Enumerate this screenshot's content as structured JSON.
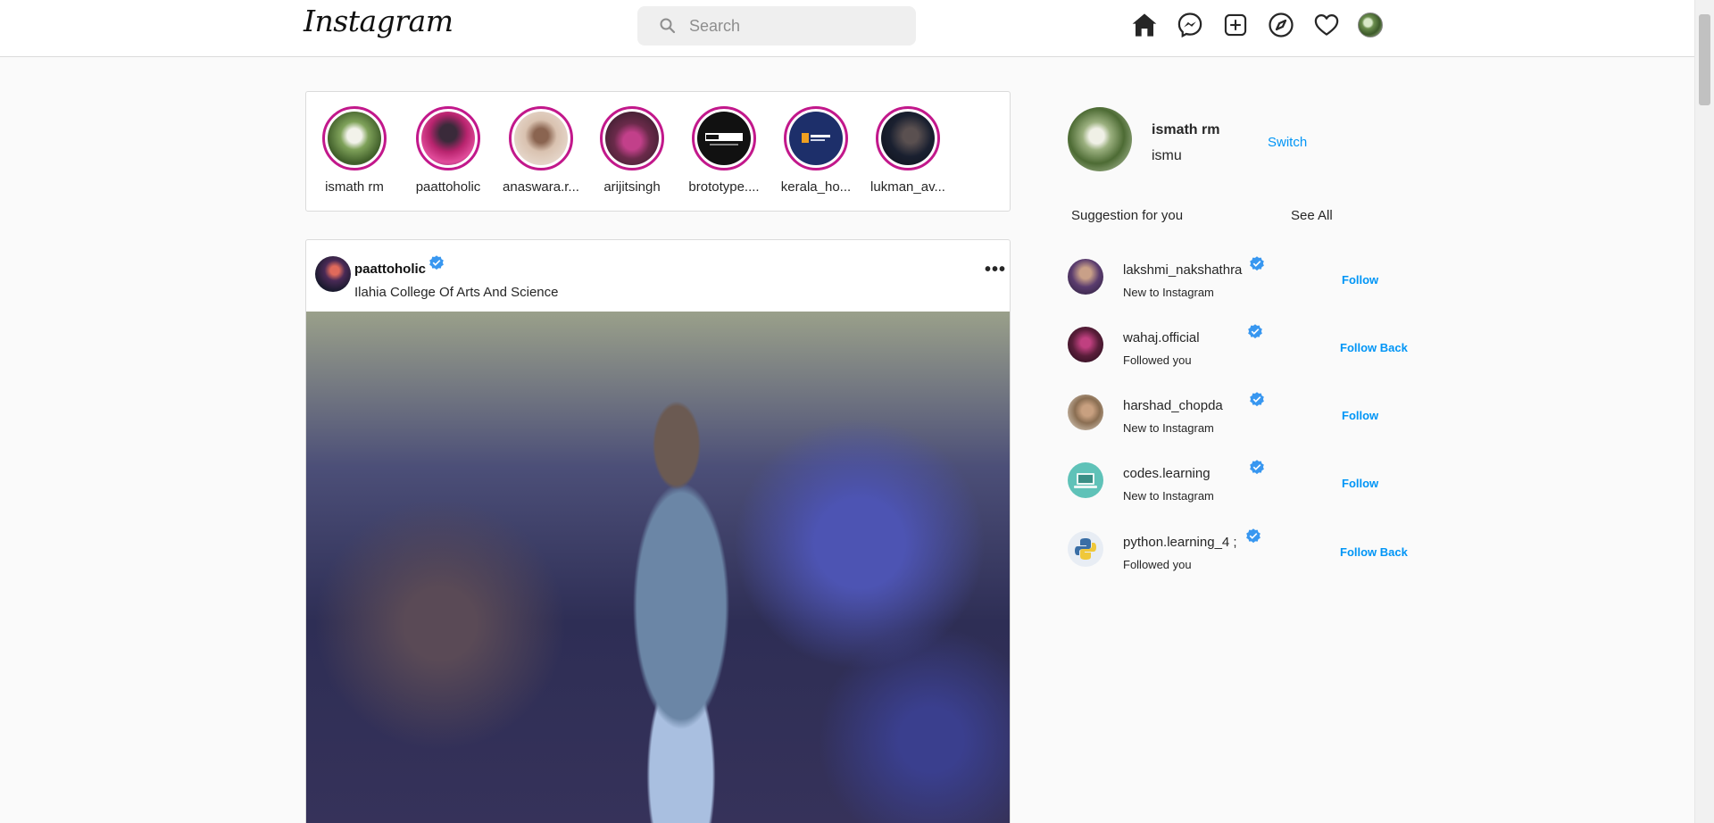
{
  "header": {
    "logo": "Instagram",
    "search_placeholder": "Search",
    "nav_icons": [
      "home-icon",
      "messenger-icon",
      "new-post-icon",
      "explore-icon",
      "activity-icon",
      "profile-avatar"
    ]
  },
  "stories": [
    {
      "name": "ismath rm",
      "color": "#7fa25a"
    },
    {
      "name": "paattoholic",
      "color": "#b8246e"
    },
    {
      "name": "anaswara.r...",
      "color": "#d9c2b0"
    },
    {
      "name": "arijitsingh",
      "color": "#6a2a4a"
    },
    {
      "name": "brototype....",
      "color": "#111111"
    },
    {
      "name": "kerala_ho...",
      "color": "#1d2f6a"
    },
    {
      "name": "lukman_av...",
      "color": "#1a2030"
    }
  ],
  "post": {
    "username": "paattoholic",
    "location": "Ilahia College Of Arts And Science",
    "more": "•••"
  },
  "profile": {
    "name": "ismath rm",
    "handle": "ismu",
    "switch_label": "Switch"
  },
  "suggestions": {
    "title": "Suggestion for you",
    "see_all": "See All",
    "items": [
      {
        "username": "lakshmi_nakshathra",
        "subtitle": "New to Instagram",
        "action": "Follow",
        "color": "#5a3c6e"
      },
      {
        "username": "wahaj.official",
        "subtitle": "Followed you",
        "action": "Follow Back",
        "color": "#5a1e3a"
      },
      {
        "username": "harshad_chopda",
        "subtitle": "New to Instagram",
        "action": "Follow",
        "color": "#8a6e52"
      },
      {
        "username": "codes.learning",
        "subtitle": "New to Instagram",
        "action": "Follow",
        "color": "#5fc2b8"
      },
      {
        "username": "python.learning_4 ;",
        "subtitle": "Followed you",
        "action": "Follow Back",
        "color": "#3a6ea5"
      }
    ]
  },
  "colors": {
    "accent": "#0095f6",
    "story_ring": "#c2188b",
    "verified": "#3897f0"
  }
}
